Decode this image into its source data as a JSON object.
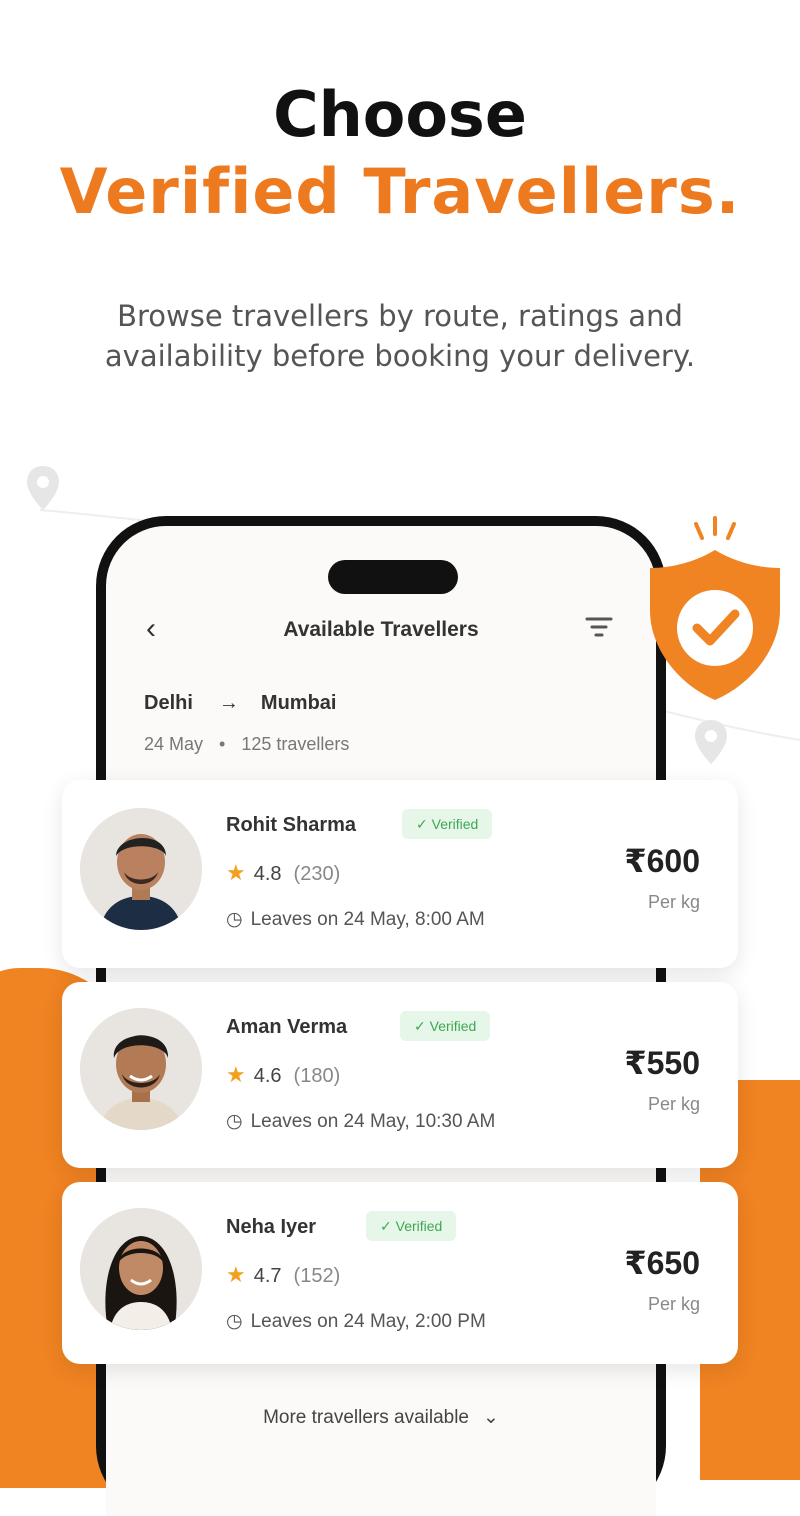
{
  "hero": {
    "title_line1": "Choose",
    "title_line2": "Verified Travellers.",
    "subtitle": "Browse travellers by route, ratings and availability before booking your delivery."
  },
  "screen": {
    "title": "Available Travellers",
    "back_icon": "chevron-left-icon",
    "filter_icon": "filter-icon",
    "route": {
      "from": "Delhi",
      "to": "Mumbai",
      "date": "24 May",
      "count": "125 travellers"
    },
    "more_label": "More travellers available"
  },
  "travellers": [
    {
      "name": "Rohit Sharma",
      "badge": "Verified",
      "rating": "4.8",
      "reviews": "(230)",
      "leaves": "Leaves on 24 May, 8:00 AM",
      "price": "₹600",
      "unit": "Per kg"
    },
    {
      "name": "Aman Verma",
      "badge": "Verified",
      "rating": "4.6",
      "reviews": "(180)",
      "leaves": "Leaves on 24 May, 10:30 AM",
      "price": "₹550",
      "unit": "Per kg"
    },
    {
      "name": "Neha Iyer",
      "badge": "Verified",
      "rating": "4.7",
      "reviews": "(152)",
      "leaves": "Leaves on 24 May, 2:00 PM",
      "price": "₹650",
      "unit": "Per kg"
    }
  ],
  "colors": {
    "accent": "#ee7a20",
    "verified_bg": "#e6f6e8",
    "verified_text": "#3fa753",
    "star": "#f2a01e"
  }
}
